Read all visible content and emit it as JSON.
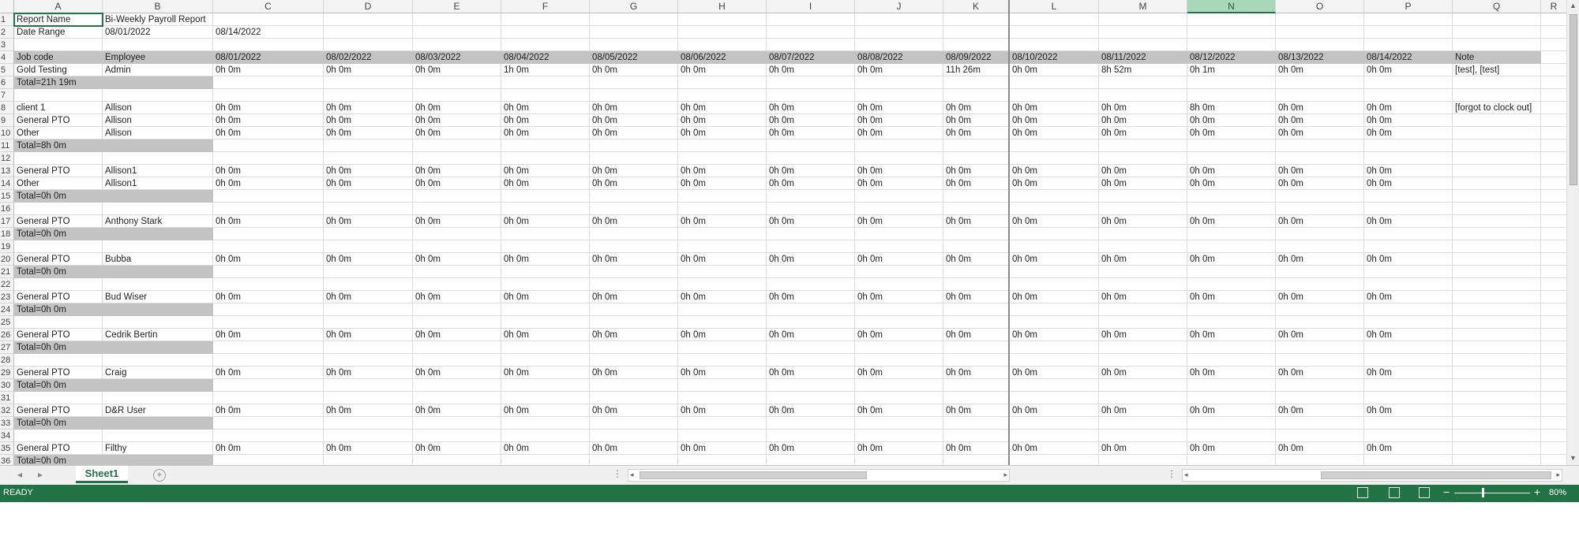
{
  "sheet": {
    "columns_left": [
      "A",
      "B",
      "C",
      "D",
      "E",
      "F",
      "G",
      "H",
      "I",
      "J",
      "K"
    ],
    "columns_right": [
      "L",
      "M",
      "N",
      "O",
      "P",
      "Q",
      "R"
    ],
    "selected_column": "N",
    "rows": [
      {
        "num": "1",
        "cells": {
          "A": "Report Name",
          "B": "Bi-Weekly Payroll Report"
        }
      },
      {
        "num": "2",
        "cells": {
          "A": "Date Range",
          "B": "08/01/2022",
          "C": "08/14/2022"
        }
      },
      {
        "num": "3",
        "cells": {}
      },
      {
        "num": "4",
        "header": true,
        "cells": {
          "A": "Job code",
          "B": "Employee",
          "C": "08/01/2022",
          "D": "08/02/2022",
          "E": "08/03/2022",
          "F": "08/04/2022",
          "G": "08/05/2022",
          "H": "08/06/2022",
          "I": "08/07/2022",
          "J": "08/08/2022",
          "K": "08/09/2022",
          "L": "08/10/2022",
          "M": "08/11/2022",
          "N": "08/12/2022",
          "O": "08/13/2022",
          "P": "08/14/2022",
          "Q": "Note"
        }
      },
      {
        "num": "5",
        "cells": {
          "A": "Gold Testing",
          "B": "Admin",
          "C": "0h 0m",
          "D": "0h 0m",
          "E": "0h 0m",
          "F": "1h 0m",
          "G": "0h 0m",
          "H": "0h 0m",
          "I": "0h 0m",
          "J": "0h 0m",
          "K": "11h 26m",
          "L": "0h 0m",
          "M": "8h 52m",
          "N": "0h 1m",
          "O": "0h 0m",
          "P": "0h 0m",
          "Q": "[test], [test]"
        }
      },
      {
        "num": "6",
        "total": true,
        "cells": {
          "A": "Total=21h 19m"
        }
      },
      {
        "num": "7",
        "cells": {}
      },
      {
        "num": "8",
        "cells": {
          "A": "client 1",
          "B": "Allison",
          "C": "0h 0m",
          "D": "0h 0m",
          "E": "0h 0m",
          "F": "0h 0m",
          "G": "0h 0m",
          "H": "0h 0m",
          "I": "0h 0m",
          "J": "0h 0m",
          "K": "0h 0m",
          "L": "0h 0m",
          "M": "0h 0m",
          "N": "8h 0m",
          "O": "0h 0m",
          "P": "0h 0m",
          "Q": "[forgot to clock out]"
        }
      },
      {
        "num": "9",
        "cells": {
          "A": "General PTO",
          "B": "Allison",
          "C": "0h 0m",
          "D": "0h 0m",
          "E": "0h 0m",
          "F": "0h 0m",
          "G": "0h 0m",
          "H": "0h 0m",
          "I": "0h 0m",
          "J": "0h 0m",
          "K": "0h 0m",
          "L": "0h 0m",
          "M": "0h 0m",
          "N": "0h 0m",
          "O": "0h 0m",
          "P": "0h 0m"
        }
      },
      {
        "num": "10",
        "cells": {
          "A": "Other",
          "B": "Allison",
          "C": "0h 0m",
          "D": "0h 0m",
          "E": "0h 0m",
          "F": "0h 0m",
          "G": "0h 0m",
          "H": "0h 0m",
          "I": "0h 0m",
          "J": "0h 0m",
          "K": "0h 0m",
          "L": "0h 0m",
          "M": "0h 0m",
          "N": "0h 0m",
          "O": "0h 0m",
          "P": "0h 0m"
        }
      },
      {
        "num": "11",
        "total": true,
        "cells": {
          "A": "Total=8h 0m"
        }
      },
      {
        "num": "12",
        "cells": {}
      },
      {
        "num": "13",
        "cells": {
          "A": "General PTO",
          "B": "Allison1",
          "C": "0h 0m",
          "D": "0h 0m",
          "E": "0h 0m",
          "F": "0h 0m",
          "G": "0h 0m",
          "H": "0h 0m",
          "I": "0h 0m",
          "J": "0h 0m",
          "K": "0h 0m",
          "L": "0h 0m",
          "M": "0h 0m",
          "N": "0h 0m",
          "O": "0h 0m",
          "P": "0h 0m"
        }
      },
      {
        "num": "14",
        "cells": {
          "A": "Other",
          "B": "Allison1",
          "C": "0h 0m",
          "D": "0h 0m",
          "E": "0h 0m",
          "F": "0h 0m",
          "G": "0h 0m",
          "H": "0h 0m",
          "I": "0h 0m",
          "J": "0h 0m",
          "K": "0h 0m",
          "L": "0h 0m",
          "M": "0h 0m",
          "N": "0h 0m",
          "O": "0h 0m",
          "P": "0h 0m"
        }
      },
      {
        "num": "15",
        "total": true,
        "cells": {
          "A": "Total=0h 0m"
        }
      },
      {
        "num": "16",
        "cells": {}
      },
      {
        "num": "17",
        "cells": {
          "A": "General PTO",
          "B": "Anthony Stark",
          "C": "0h 0m",
          "D": "0h 0m",
          "E": "0h 0m",
          "F": "0h 0m",
          "G": "0h 0m",
          "H": "0h 0m",
          "I": "0h 0m",
          "J": "0h 0m",
          "K": "0h 0m",
          "L": "0h 0m",
          "M": "0h 0m",
          "N": "0h 0m",
          "O": "0h 0m",
          "P": "0h 0m"
        }
      },
      {
        "num": "18",
        "total": true,
        "cells": {
          "A": "Total=0h 0m"
        }
      },
      {
        "num": "19",
        "cells": {}
      },
      {
        "num": "20",
        "cells": {
          "A": "General PTO",
          "B": "Bubba",
          "C": "0h 0m",
          "D": "0h 0m",
          "E": "0h 0m",
          "F": "0h 0m",
          "G": "0h 0m",
          "H": "0h 0m",
          "I": "0h 0m",
          "J": "0h 0m",
          "K": "0h 0m",
          "L": "0h 0m",
          "M": "0h 0m",
          "N": "0h 0m",
          "O": "0h 0m",
          "P": "0h 0m"
        }
      },
      {
        "num": "21",
        "total": true,
        "cells": {
          "A": "Total=0h 0m"
        }
      },
      {
        "num": "22",
        "cells": {}
      },
      {
        "num": "23",
        "cells": {
          "A": "General PTO",
          "B": "Bud Wiser",
          "C": "0h 0m",
          "D": "0h 0m",
          "E": "0h 0m",
          "F": "0h 0m",
          "G": "0h 0m",
          "H": "0h 0m",
          "I": "0h 0m",
          "J": "0h 0m",
          "K": "0h 0m",
          "L": "0h 0m",
          "M": "0h 0m",
          "N": "0h 0m",
          "O": "0h 0m",
          "P": "0h 0m"
        }
      },
      {
        "num": "24",
        "total": true,
        "cells": {
          "A": "Total=0h 0m"
        }
      },
      {
        "num": "25",
        "cells": {}
      },
      {
        "num": "26",
        "cells": {
          "A": "General PTO",
          "B": "Cedrik Bertin",
          "C": "0h 0m",
          "D": "0h 0m",
          "E": "0h 0m",
          "F": "0h 0m",
          "G": "0h 0m",
          "H": "0h 0m",
          "I": "0h 0m",
          "J": "0h 0m",
          "K": "0h 0m",
          "L": "0h 0m",
          "M": "0h 0m",
          "N": "0h 0m",
          "O": "0h 0m",
          "P": "0h 0m"
        }
      },
      {
        "num": "27",
        "total": true,
        "cells": {
          "A": "Total=0h 0m"
        }
      },
      {
        "num": "28",
        "cells": {}
      },
      {
        "num": "29",
        "cells": {
          "A": "General PTO",
          "B": "Craig",
          "C": "0h 0m",
          "D": "0h 0m",
          "E": "0h 0m",
          "F": "0h 0m",
          "G": "0h 0m",
          "H": "0h 0m",
          "I": "0h 0m",
          "J": "0h 0m",
          "K": "0h 0m",
          "L": "0h 0m",
          "M": "0h 0m",
          "N": "0h 0m",
          "O": "0h 0m",
          "P": "0h 0m"
        }
      },
      {
        "num": "30",
        "total": true,
        "cells": {
          "A": "Total=0h 0m"
        }
      },
      {
        "num": "31",
        "cells": {}
      },
      {
        "num": "32",
        "cells": {
          "A": "General PTO",
          "B": "D&R User",
          "C": "0h 0m",
          "D": "0h 0m",
          "E": "0h 0m",
          "F": "0h 0m",
          "G": "0h 0m",
          "H": "0h 0m",
          "I": "0h 0m",
          "J": "0h 0m",
          "K": "0h 0m",
          "L": "0h 0m",
          "M": "0h 0m",
          "N": "0h 0m",
          "O": "0h 0m",
          "P": "0h 0m"
        }
      },
      {
        "num": "33",
        "total": true,
        "cells": {
          "A": "Total=0h 0m"
        }
      },
      {
        "num": "34",
        "cells": {}
      },
      {
        "num": "35",
        "cells": {
          "A": "General PTO",
          "B": "Filthy",
          "C": "0h 0m",
          "D": "0h 0m",
          "E": "0h 0m",
          "F": "0h 0m",
          "G": "0h 0m",
          "H": "0h 0m",
          "I": "0h 0m",
          "J": "0h 0m",
          "K": "0h 0m",
          "L": "0h 0m",
          "M": "0h 0m",
          "N": "0h 0m",
          "O": "0h 0m",
          "P": "0h 0m"
        }
      },
      {
        "num": "36",
        "total": true,
        "cells": {
          "A": "Total=0h 0m"
        }
      }
    ]
  },
  "tabs": {
    "active_sheet": "Sheet1",
    "add_icon": "plus-circle-icon"
  },
  "status": {
    "mode": "READY",
    "zoom": "80%"
  },
  "colors": {
    "accent": "#217346",
    "total_fill": "#c3c3c3",
    "selected_column_fill": "#a8d8b9"
  }
}
